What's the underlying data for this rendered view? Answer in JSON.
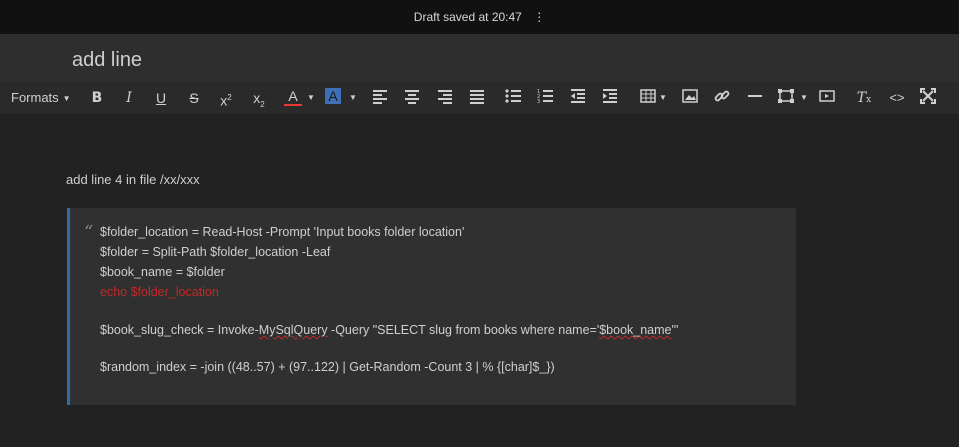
{
  "topbar": {
    "draft_status": "Draft saved at 20:47",
    "menu_icon": "vertical-dots-icon"
  },
  "title": "add line",
  "toolbar": {
    "formats_label": "Formats",
    "buttons": [
      "bold-icon",
      "italic-icon",
      "underline-icon",
      "strikethrough-icon",
      "superscript-icon",
      "subscript-icon",
      "text-color-icon",
      "background-color-icon",
      "align-left-icon",
      "align-center-icon",
      "align-right-icon",
      "justify-icon",
      "bullet-list-icon",
      "numbered-list-icon",
      "outdent-icon",
      "indent-icon",
      "table-icon",
      "image-icon",
      "link-icon",
      "horizontal-rule-icon",
      "media-icon",
      "code-sample-icon",
      "clear-formatting-icon",
      "source-code-icon",
      "fullscreen-icon"
    ],
    "colors": {
      "text_color_swatch": "#e53935",
      "background_color_swatch": "#3f6fb5"
    }
  },
  "editor": {
    "intro": "add line 4 in file /xx/xxx",
    "quote_mark": "“",
    "code_lines": [
      "$folder_location = Read-Host -Prompt 'Input books folder location'",
      "$folder = Split-Path $folder_location -Leaf",
      "$book_name = $folder",
      "echo $folder_location",
      "$book_slug_check = Invoke-",
      "MySqlQuery",
      " -Query \"SELECT slug from books where name='",
      "$book_name",
      "'\"",
      "$random_index = -join ((48..57) + (97..122) | Get-Random -Count 3 | % {[char]$_})"
    ]
  },
  "colors": {
    "accent_quote_border": "#2f6ea5",
    "error_red": "#c62828"
  }
}
